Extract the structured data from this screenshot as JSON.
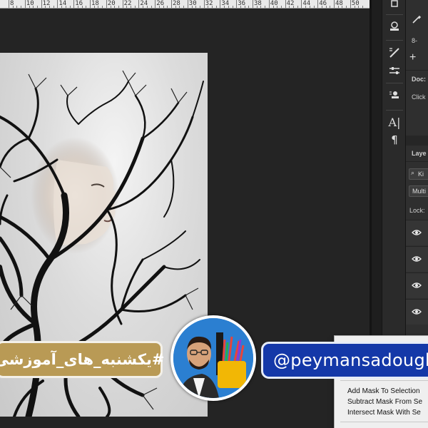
{
  "ruler": {
    "labels": [
      "8",
      "10",
      "12",
      "14",
      "16",
      "18",
      "20",
      "22",
      "24",
      "26",
      "28",
      "30",
      "32",
      "34",
      "36",
      "38",
      "40",
      "42",
      "44",
      "46",
      "48",
      "50"
    ]
  },
  "panel": {
    "zoom_fragment": "8-",
    "doc_label": "Doc:",
    "click_label": "Click",
    "layers_tab": "Laye",
    "kind_label": "Ki",
    "blend_mode": "Multi",
    "lock_label": "Lock:"
  },
  "context_menu": {
    "items": [
      "Add Mask To Selection",
      "Subtract Mask From Se",
      "Intersect Mask With Se"
    ]
  },
  "overlay": {
    "hashtag": "#یکشنبه_های_آموزشی",
    "handle": "@peymansadoughi"
  },
  "tool_icons": [
    "brush-erase-icon",
    "stamp-icon",
    "brush-icon",
    "adjust-icon",
    "stamp-tool-icon",
    "type-icon",
    "paragraph-icon"
  ]
}
